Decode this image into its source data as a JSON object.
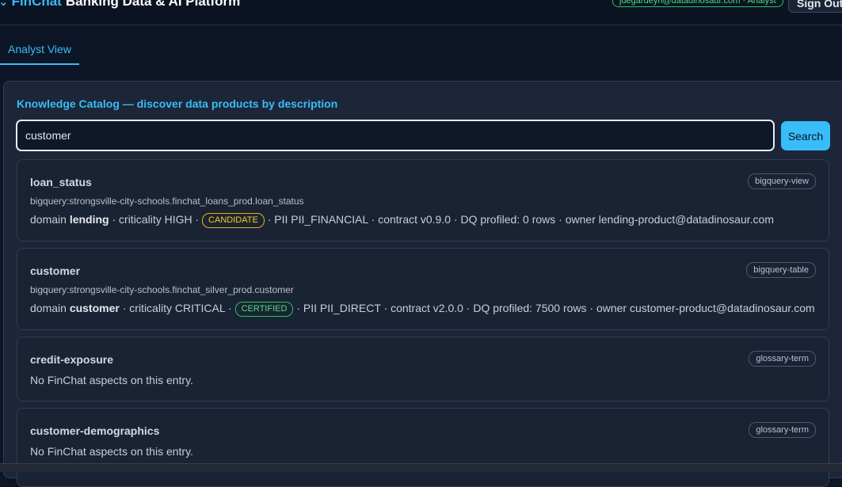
{
  "header": {
    "brand_accent": "FinChat",
    "brand_rest": "Banking Data & AI Platform",
    "user_badge": "jdegardeyn@datadinosaur.com · Analyst",
    "signout_label": "Sign Out"
  },
  "tabs": [
    {
      "label": "Analyst View",
      "active": true
    }
  ],
  "catalog": {
    "title": "Knowledge Catalog — discover data products by description",
    "search_value": "customer ",
    "search_button": "Search"
  },
  "results": [
    {
      "name": "loan_status",
      "type": "bigquery-view",
      "path": "bigquery:strongsville-city-schools.finchat_loans_prod.loan_status",
      "domain_label": "domain",
      "domain": "lending",
      "criticality": "· criticality HIGH ·",
      "status": "CANDIDATE",
      "rest": "· PII PII_FINANCIAL · contract v0.9.0 · DQ profiled: 0 rows · owner lending-product@datadinosaur.com"
    },
    {
      "name": "customer",
      "type": "bigquery-table",
      "path": "bigquery:strongsville-city-schools.finchat_silver_prod.customer",
      "domain_label": "domain",
      "domain": "customer",
      "criticality": "· criticality CRITICAL ·",
      "status": "CERTIFIED",
      "rest": "· PII PII_DIRECT · contract v2.0.0 · DQ profiled: 7500 rows · owner customer-product@datadinosaur.com"
    },
    {
      "name": "credit-exposure",
      "type": "glossary-term",
      "empty_text": "No FinChat aspects on this entry."
    },
    {
      "name": "customer-demographics",
      "type": "glossary-term",
      "empty_text": "No FinChat aspects on this entry."
    }
  ],
  "colors": {
    "accent": "#38bdf8",
    "candidate": "#facc15",
    "certified": "#4ade80",
    "background": "#0d1626"
  }
}
